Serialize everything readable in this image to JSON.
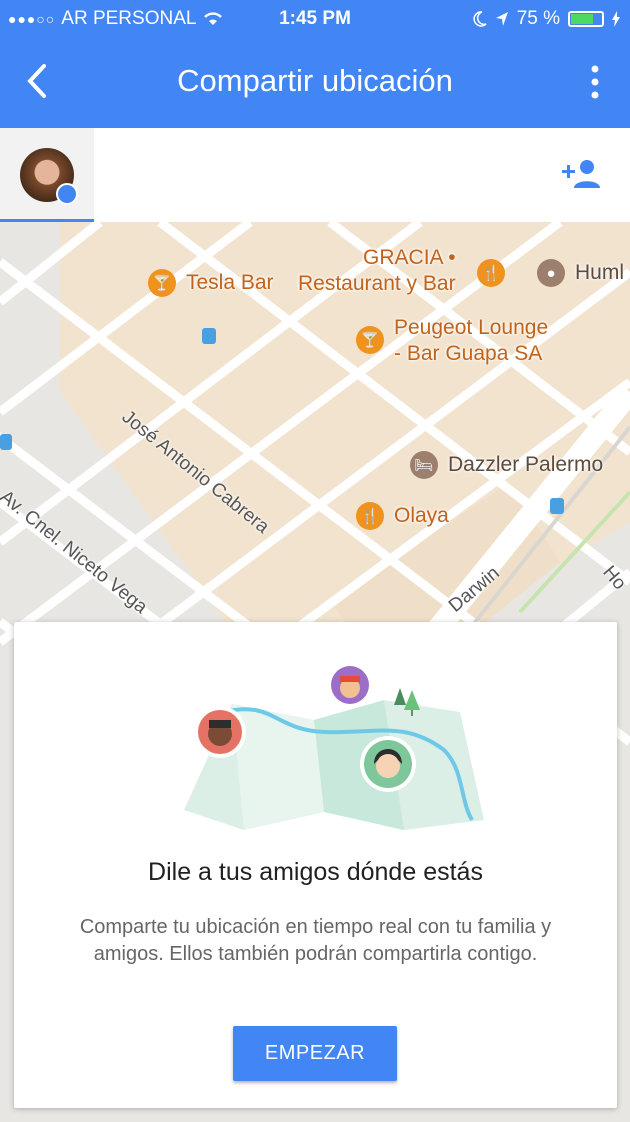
{
  "status_bar": {
    "carrier": "AR PERSONAL",
    "time": "1:45 PM",
    "battery": "75 %",
    "battery_level": 0.75
  },
  "app_bar": {
    "title": "Compartir ubicación"
  },
  "map": {
    "pois": {
      "tesla": "Tesla Bar",
      "gracia_1": "GRACIA •",
      "gracia_2": "Restaurant y Bar",
      "hum": "Huml",
      "peugeot_1": "Peugeot Lounge",
      "peugeot_2": "- Bar Guapa SA",
      "dazzler": "Dazzler Palermo",
      "olaya": "Olaya"
    },
    "streets": {
      "cabrera": "José Antonio Cabrera",
      "niceto": "Av. Cnel. Niceto Vega",
      "darwin": "Darwin",
      "right_ho": "Ho"
    }
  },
  "card": {
    "heading": "Dile a tus amigos dónde estás",
    "body": "Comparte tu ubicación en tiempo real con tu familia y amigos. Ellos también podrán compartirla contigo.",
    "button": "EMPEZAR"
  },
  "colors": {
    "primary": "#4285f4",
    "poi_orange": "#f0931e",
    "map_bg": "#e5e3df"
  },
  "icons": [
    "back-arrow-icon",
    "more-vert-icon",
    "add-person-icon",
    "wifi-icon",
    "moon-icon",
    "location-arrow-icon",
    "bolt-icon",
    "bar-icon",
    "restaurant-icon",
    "hotel-icon",
    "place-icon",
    "transit-icon"
  ]
}
